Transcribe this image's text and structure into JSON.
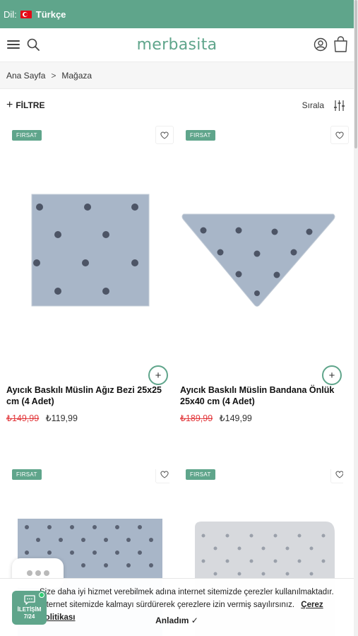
{
  "lang_bar": {
    "label": "Dil:",
    "language": "Türkçe"
  },
  "header": {
    "logo": "merbasita"
  },
  "breadcrumb": {
    "home": "Ana Sayfa",
    "separator": ">",
    "current": "Mağaza"
  },
  "toolbar": {
    "filter_icon": "+",
    "filter_label": "FİLTRE",
    "sort_label": "Sırala"
  },
  "products": [
    {
      "badge": "FIRSAT",
      "title": "Ayıcık Baskılı Müslin Ağız Bezi 25x25 cm (4 Adet)",
      "old_price": "₺149,99",
      "new_price": "₺119,99"
    },
    {
      "badge": "FIRSAT",
      "title": "Ayıcık Baskılı Müslin Bandana Önlük 25x40 cm (4 Adet)",
      "old_price": "₺189,99",
      "new_price": "₺149,99"
    },
    {
      "badge": "FIRSAT"
    },
    {
      "badge": "FIRSAT"
    }
  ],
  "cookie": {
    "text": "Size daha iyi hizmet verebilmek adına internet sitemizde çerezler kullanılmaktadır. İnternet sitemizde kalmayı sürdürerek çerezlere izin vermiş sayılırsınız.",
    "policy_link": "Çerez Politikası",
    "accept_label": "Anladım ✓"
  },
  "contact": {
    "line1": "İLETİŞİM",
    "line2": "7/24"
  },
  "icons": {
    "flag": "turkey-flag-icon",
    "menu": "hamburger-menu-icon",
    "search": "search-icon",
    "account": "user-account-icon",
    "cart": "shopping-bag-icon",
    "favorite": "heart-icon",
    "add": "plus-circle-icon",
    "sort": "sort-sliders-icon",
    "chat": "chat-icon"
  },
  "colors": {
    "brand": "#5fa58b",
    "old_price": "#e2363a",
    "fabric_blue": "#a8b6c8",
    "fabric_grey": "#d7d9dd"
  }
}
